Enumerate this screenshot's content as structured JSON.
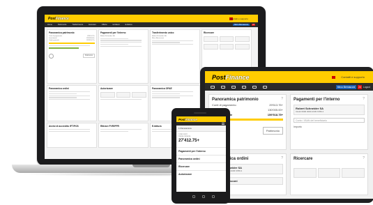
{
  "brand": {
    "logo_part1": "Post",
    "logo_part2": "Finance",
    "yellow": "#ffcc00",
    "dark": "#2a2a2a"
  },
  "laptop": {
    "support": "Contatti e supporto",
    "nav": [
      "Home",
      "Patrimonio",
      "Trasferimento",
      "Eurocaro",
      "Offerte",
      "E-bilanci",
      "E-fattura"
    ],
    "user": "Mirco Bernasconi",
    "cards": {
      "c1": "Panoramica patrimonio",
      "c2": "Pagamenti per l'interno",
      "c3": "Trasferimento unico",
      "c4": "Ricercare",
      "c5": "Panoramica ordini",
      "c6": "Autorizzare",
      "c7": "Panoramica OPAE",
      "c8": "Avvisi di accredito IFT/POS",
      "c9": "Ritirare PVR/PPR",
      "c10": "E-fattura"
    },
    "patrimonio_button": "Patrimonio"
  },
  "tablet": {
    "support": "Contatti e supporto",
    "user": "Mirco Bernasconi",
    "badge": "24",
    "logout": "Logout",
    "card1": {
      "title": "Panoramica patrimonio",
      "rows": [
        {
          "label": "Conti di pagamento",
          "value": "29'513.75+"
        },
        {
          "label": "Investimenti",
          "value": "130'005.00+"
        },
        {
          "label": "Totale generale",
          "value": "159'518.75+"
        }
      ],
      "button": "Patrimonio"
    },
    "card2": {
      "title": "Pagamenti per l'interno",
      "account_name": "Robert Schneider SA",
      "account_nr": "CH42 0900 0000 2345 6789 2",
      "search": "Conto / IBAN del beneficiario",
      "extra": "Importo"
    },
    "card3": {
      "title": "Panoramica ordini"
    },
    "card4": {
      "title": "Ricercare"
    },
    "c3_account_name": "Robert Schneider SA",
    "c3_account_nr": "CH42 0900 0000 2345 6789 2",
    "c3_account2": "Mirco Bernasconi"
  },
  "phone": {
    "section": "1 Panoramica",
    "label1": "I miei conti",
    "label2": "Conto corrente",
    "value": "27'412.75+",
    "item1": "Pagamenti per l'interno",
    "item2": "Panoramica ordini",
    "item3": "Ricercare",
    "item4": "Autorizzare"
  }
}
